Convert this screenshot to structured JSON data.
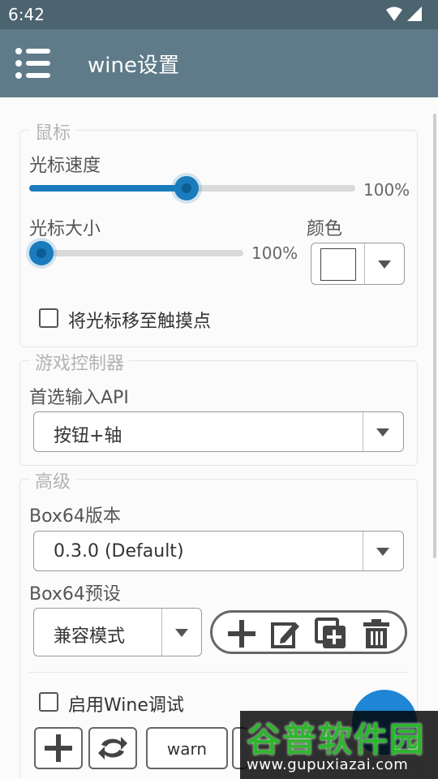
{
  "status": {
    "time": "6:42"
  },
  "header": {
    "title": "wine设置",
    "menu_icon": "menu-icon"
  },
  "mouse": {
    "title": "鼠标",
    "cursor_speed": {
      "label": "光标速度",
      "value_text": "100%",
      "level": 0.48
    },
    "cursor_size": {
      "label": "光标大小",
      "value_text": "100%",
      "level": 0.0
    },
    "color_label": "颜色",
    "color_value": "#ffffff",
    "move_to_touch": {
      "label": "将光标移至触摸点",
      "checked": false
    }
  },
  "controller": {
    "title": "游戏控制器",
    "api_label": "首选输入API",
    "api_value": "按钮+轴"
  },
  "advanced": {
    "title": "高级",
    "box64_version_label": "Box64版本",
    "box64_version_value": "0.3.0 (Default)",
    "box64_preset_label": "Box64预设",
    "box64_preset_value": "兼容模式",
    "preset_actions": [
      "add-icon",
      "edit-icon",
      "duplicate-icon",
      "delete-icon"
    ],
    "wine_debug": {
      "label": "启用Wine调试",
      "checked": false
    },
    "debug_buttons": {
      "warn_label": "warn"
    }
  },
  "watermark": {
    "title": "谷普软件园",
    "site": "www.gupuxiazai.com"
  },
  "colors": {
    "status_bar": "#4c6370",
    "app_bar": "#5f7b89",
    "accent": "#1a7bbd"
  }
}
